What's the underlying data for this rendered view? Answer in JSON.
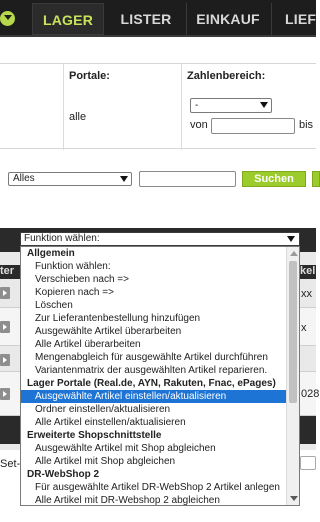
{
  "nav": {
    "tabs": [
      {
        "label": "LAGER",
        "active": true
      },
      {
        "label": "LISTER",
        "active": false
      },
      {
        "label": "EINKAUF",
        "active": false
      },
      {
        "label": "LIEF",
        "active": false
      }
    ]
  },
  "filters": {
    "portale_label": "Portale:",
    "portale_value": "alle",
    "zahlenbereich_label": "Zahlenbereich:",
    "zahlenbereich_select": "-",
    "von_label": "von",
    "bis_label": "bis"
  },
  "search": {
    "scope_select": "Alles",
    "query": "",
    "button": "Suchen"
  },
  "table": {
    "header_left": "ter",
    "header_right": "kel",
    "cells_right": [
      "xx",
      "x",
      "",
      "028"
    ],
    "footer_left": "Set-"
  },
  "dropdown": {
    "selected": "Funktion wählen:",
    "options": [
      {
        "type": "group",
        "label": "Allgemein"
      },
      {
        "type": "item",
        "label": "Funktion wählen:"
      },
      {
        "type": "item",
        "label": "Verschieben nach =>"
      },
      {
        "type": "item",
        "label": "Kopieren nach =>"
      },
      {
        "type": "item",
        "label": "Löschen"
      },
      {
        "type": "item",
        "label": "Zur Lieferantenbestellung hinzufügen"
      },
      {
        "type": "item",
        "label": "Ausgewählte Artikel überarbeiten"
      },
      {
        "type": "item",
        "label": "Alle Artikel überarbeiten"
      },
      {
        "type": "item",
        "label": "Mengenabgleich für ausgewählte Artikel durchführen"
      },
      {
        "type": "item",
        "label": "Variantenmatrix der ausgewählten Artikel reparieren."
      },
      {
        "type": "group",
        "label": "Lager Portale (Real.de, AYN, Rakuten, Fnac, ePages)"
      },
      {
        "type": "item",
        "label": "Ausgewählte Artikel einstellen/aktualisieren",
        "highlighted": true
      },
      {
        "type": "item",
        "label": "Ordner einstellen/aktualisieren"
      },
      {
        "type": "item",
        "label": "Alle Artikel einstellen/aktualisieren"
      },
      {
        "type": "group",
        "label": "Erweiterte Shopschnittstelle"
      },
      {
        "type": "item",
        "label": "Ausgewählte Artikel mit Shop abgleichen"
      },
      {
        "type": "item",
        "label": "Alle Artikel mit Shop abgleichen"
      },
      {
        "type": "group",
        "label": "DR-WebShop 2"
      },
      {
        "type": "item",
        "label": "Für ausgewählte Artikel DR-WebShop 2 Artikel anlegen"
      },
      {
        "type": "item",
        "label": "Alle Artikel mit DR-Webshop 2 abgleichen"
      }
    ]
  },
  "colors": {
    "nav_bg": "#1d1d1d",
    "accent_green": "#9ccb2c",
    "active_tab_text": "#c7e45a",
    "highlight": "#1e74d4"
  }
}
